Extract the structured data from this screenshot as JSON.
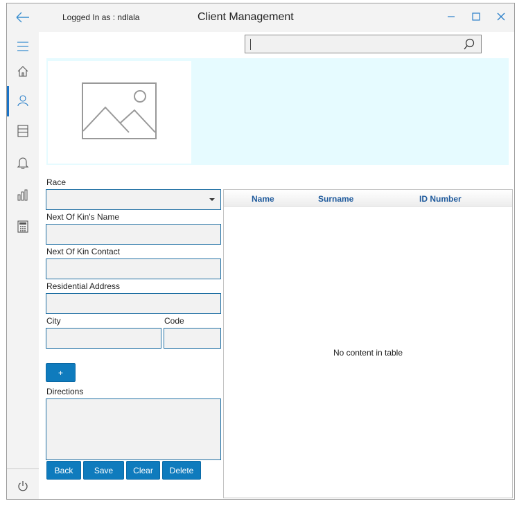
{
  "header": {
    "logged_in": "Logged In as : ndlala",
    "title": "Client Management"
  },
  "sidebar": {
    "items": [
      {
        "icon": "hamburger-icon"
      },
      {
        "icon": "home-icon"
      },
      {
        "icon": "user-icon",
        "active": true
      },
      {
        "icon": "list-icon"
      },
      {
        "icon": "bell-icon"
      },
      {
        "icon": "bar-chart-icon"
      },
      {
        "icon": "calculator-icon"
      },
      {
        "icon": "power-icon"
      }
    ]
  },
  "search": {
    "value": ""
  },
  "form": {
    "race_label": "Race",
    "race_value": "",
    "kin_name_label": "Next Of Kin's Name",
    "kin_name_value": "",
    "kin_contact_label": "Next Of Kin Contact",
    "kin_contact_value": "",
    "address_label": "Residential Address",
    "address_value": "",
    "city_label": "City",
    "city_value": "",
    "code_label": "Code",
    "code_value": "",
    "add_label": "+",
    "directions_label": "Directions",
    "directions_value": ""
  },
  "actions": {
    "back": "Back",
    "save": "Save",
    "clear": "Clear",
    "delete": "Delete"
  },
  "table": {
    "columns": [
      "Name",
      "Surname",
      "ID Number"
    ],
    "empty_text": "No content in table"
  },
  "colors": {
    "accent": "#0f7bbd",
    "banner": "#e6fbff",
    "header_text": "#1f5a9c"
  }
}
